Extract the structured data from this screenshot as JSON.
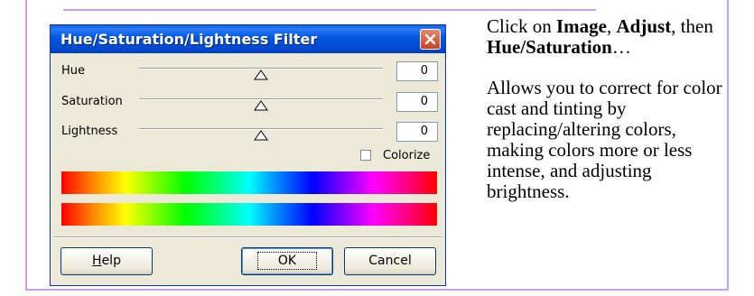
{
  "dialog": {
    "title": "Hue/Saturation/Lightness Filter",
    "rows": [
      {
        "label": "Hue",
        "value": "0"
      },
      {
        "label": "Saturation",
        "value": "0"
      },
      {
        "label": "Lightness",
        "value": "0"
      }
    ],
    "colorize_label": "Colorize",
    "colorize_checked": false,
    "buttons": {
      "help_first": "H",
      "help_rest": "elp",
      "ok": "OK",
      "cancel": "Cancel"
    }
  },
  "description": {
    "line1_prefix": "Click on ",
    "image": "Image",
    "comma": ", ",
    "adjust": "Adjust",
    "comma2": ",",
    "then": " then ",
    "hue_sat": "Hue/Saturation",
    "ellipsis": "…",
    "para2": "Allows you to correct for color cast and tinting by replacing/altering colors, making colors more or less intense, and adjusting brightness."
  },
  "colors": {
    "accent_border": "#c8a0e8",
    "title_bar": "#0355e0"
  }
}
